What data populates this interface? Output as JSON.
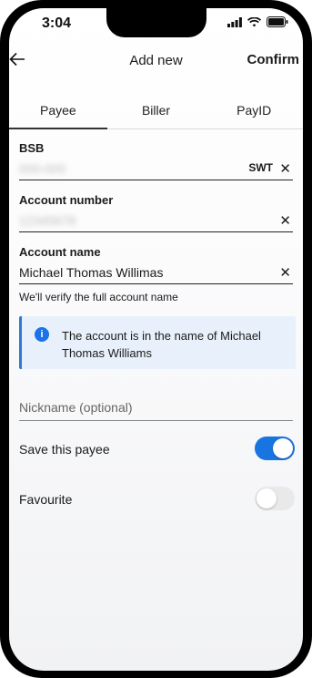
{
  "status": {
    "time": "3:04"
  },
  "header": {
    "title": "Add new",
    "confirm": "Confirm"
  },
  "tabs": [
    {
      "label": "Payee",
      "active": true
    },
    {
      "label": "Biller",
      "active": false
    },
    {
      "label": "PayID",
      "active": false
    }
  ],
  "fields": {
    "bsb": {
      "label": "BSB",
      "value": "000-000",
      "suffix": "SWT",
      "clear": "✕"
    },
    "account_number": {
      "label": "Account number",
      "value": "12345678",
      "clear": "✕"
    },
    "account_name": {
      "label": "Account name",
      "value": "Michael Thomas Willimas",
      "clear": "✕",
      "helper": "We'll verify the full account name"
    }
  },
  "info": {
    "icon": "i",
    "text": "The account is in the name of Michael Thomas Williams"
  },
  "nickname": {
    "placeholder": "Nickname (optional)"
  },
  "toggles": [
    {
      "label": "Save this payee",
      "on": true
    },
    {
      "label": "Favourite",
      "on": false
    }
  ]
}
